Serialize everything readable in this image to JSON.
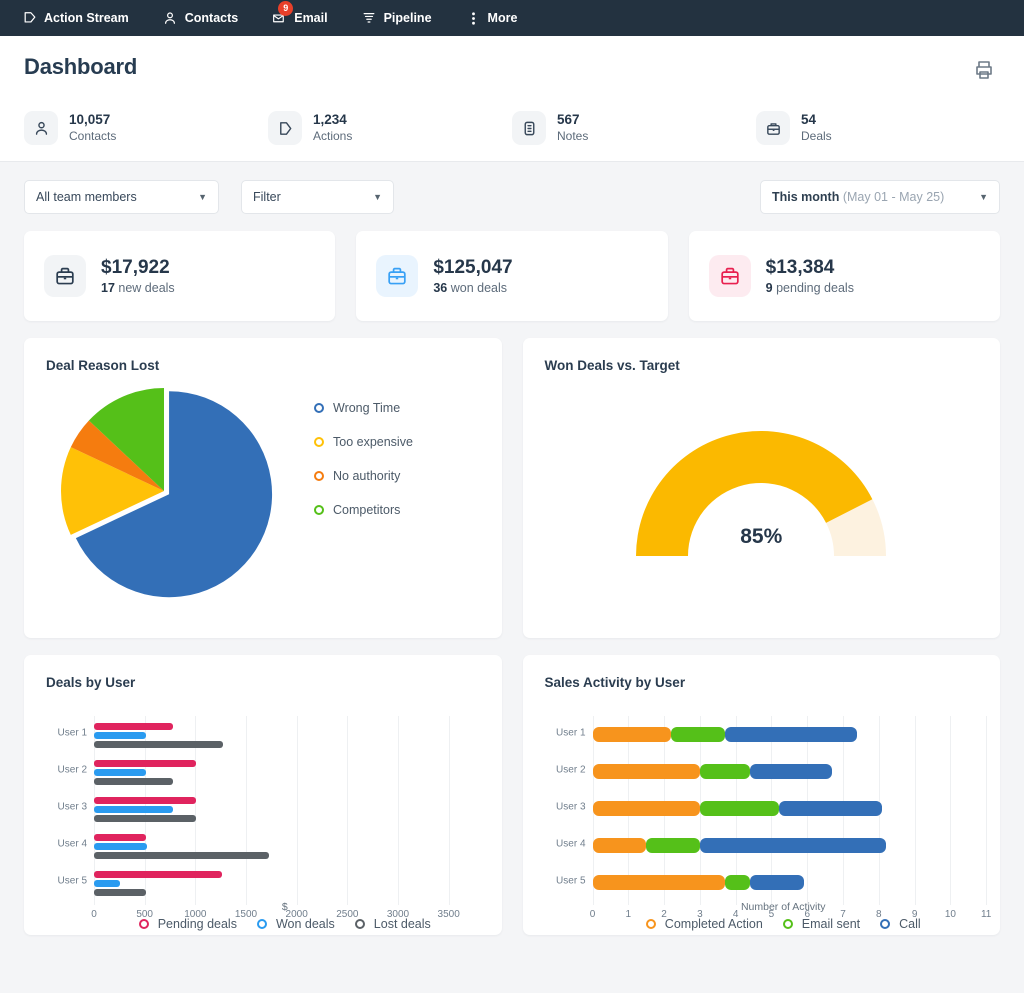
{
  "nav": {
    "items": [
      {
        "label": "Action Stream",
        "icon": "action-stream-icon"
      },
      {
        "label": "Contacts",
        "icon": "contacts-icon"
      },
      {
        "label": "Email",
        "icon": "email-icon",
        "badge": "9"
      },
      {
        "label": "Pipeline",
        "icon": "pipeline-icon"
      },
      {
        "label": "More",
        "icon": "more-icon"
      }
    ]
  },
  "header": {
    "title": "Dashboard",
    "print_icon": "printer-icon",
    "stats": [
      {
        "value": "10,057",
        "label": "Contacts",
        "icon": "contact-person-icon"
      },
      {
        "value": "1,234",
        "label": "Actions",
        "icon": "action-flag-icon"
      },
      {
        "value": "567",
        "label": "Notes",
        "icon": "note-icon"
      },
      {
        "value": "54",
        "label": "Deals",
        "icon": "briefcase-icon"
      }
    ]
  },
  "filters": {
    "team": {
      "value": "All team members",
      "placeholder": "All team members"
    },
    "filter": {
      "value": "Filter",
      "placeholder": "Filter"
    },
    "date": {
      "main": "This month",
      "range": "(May 01 - May 25)"
    }
  },
  "kpis": [
    {
      "amount": "$17,922",
      "count": "17",
      "text": "new deals",
      "color": "#2b3d50",
      "bg": "#f2f4f6"
    },
    {
      "amount": "$125,047",
      "count": "36",
      "text": "won deals",
      "color": "#38a0f5",
      "bg": "#e9f4fe"
    },
    {
      "amount": "$13,384",
      "count": "9",
      "text": "pending deals",
      "color": "#e8204f",
      "bg": "#fdebf0"
    }
  ],
  "cards": {
    "deal_reason_lost": {
      "title": "Deal Reason Lost"
    },
    "won_vs_target": {
      "title": "Won Deals vs. Target"
    },
    "deals_by_user": {
      "title": "Deals by User"
    },
    "sales_activity": {
      "title": "Sales Activity by User"
    }
  },
  "chart_data": [
    {
      "id": "deal-reason-lost",
      "type": "pie",
      "title": "Deal Reason Lost",
      "labels": [
        "Wrong Time",
        "Too expensive",
        "No authority",
        "Competitors"
      ],
      "values": [
        68,
        14,
        5,
        13
      ],
      "colors": [
        "#336fb7",
        "#ffc107",
        "#f57c0f",
        "#55c019"
      ],
      "exploded": [
        "Wrong Time"
      ],
      "legend": "right"
    },
    {
      "id": "won-deals-vs-target",
      "type": "gauge",
      "title": "Won Deals vs. Target",
      "value": 85,
      "display_value": "85%",
      "min": 0,
      "max": 100,
      "fill_color": "#fbb900",
      "track_color": "#fdf2e0"
    },
    {
      "id": "deals-by-user",
      "type": "bar",
      "orientation": "horizontal",
      "title": "Deals by User",
      "categories": [
        "User 1",
        "User 2",
        "User 3",
        "User 4",
        "User 5"
      ],
      "series": [
        {
          "name": "Pending deals",
          "color": "#e0245e",
          "values": [
            780,
            1010,
            1010,
            510,
            1260
          ]
        },
        {
          "name": "Won deals",
          "color": "#2a9bf0",
          "values": [
            510,
            510,
            780,
            520,
            260
          ]
        },
        {
          "name": "Lost deals",
          "color": "#5b6166",
          "values": [
            1270,
            780,
            1010,
            1730,
            510
          ]
        }
      ],
      "xlabel": "$",
      "ylabel": "",
      "xticks": [
        0,
        500,
        1000,
        1500,
        2000,
        2500,
        3000,
        3500
      ],
      "xlim": [
        0,
        3750
      ],
      "grid": true,
      "legend": "bottom"
    },
    {
      "id": "sales-activity-by-user",
      "type": "bar",
      "orientation": "horizontal",
      "stacked": true,
      "title": "Sales Activity by User",
      "categories": [
        "User 1",
        "User 2",
        "User 3",
        "User 4",
        "User 5"
      ],
      "series": [
        {
          "name": "Completed Action",
          "color": "#f7941d",
          "values": [
            2.2,
            3.0,
            3.0,
            1.5,
            3.7
          ]
        },
        {
          "name": "Email sent",
          "color": "#55c019",
          "values": [
            1.5,
            1.4,
            2.2,
            1.5,
            0.7
          ]
        },
        {
          "name": "Call",
          "color": "#336fb7",
          "values": [
            3.7,
            2.3,
            2.9,
            5.2,
            1.5
          ]
        }
      ],
      "xlabel": "Number of Activity",
      "ylabel": "",
      "xticks": [
        0,
        1,
        2,
        3,
        4,
        5,
        6,
        7,
        8,
        9,
        10,
        11
      ],
      "xlim": [
        0,
        11.4
      ],
      "grid": true,
      "legend": "bottom"
    }
  ]
}
